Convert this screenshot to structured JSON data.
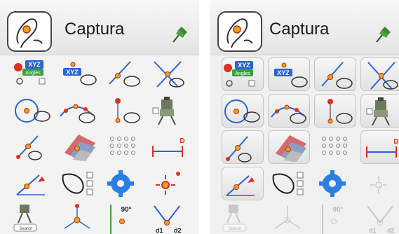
{
  "colors": {
    "accent_blue": "#2b63d6",
    "point_orange": "#f0a020",
    "point_red": "#e03020",
    "pin_green": "#3a8a2a"
  },
  "panels": [
    {
      "title": "Captura"
    },
    {
      "title": "Captura"
    }
  ],
  "icon_text": {
    "xyz": "XYZ",
    "angles": "Angles",
    "search": "Search",
    "fifty": "90°",
    "d1": "d1",
    "d2": "d2",
    "d": "D"
  },
  "tools": [
    {
      "name": "xyz-angles-icon"
    },
    {
      "name": "xyz-point-icon"
    },
    {
      "name": "line-point-icon"
    },
    {
      "name": "intersection-icon"
    },
    {
      "name": "circle-center-icon"
    },
    {
      "name": "arc-points-icon"
    },
    {
      "name": "vertical-pin-icon"
    },
    {
      "name": "total-station-icon"
    },
    {
      "name": "line-end-icon"
    },
    {
      "name": "grid-map-icon"
    },
    {
      "name": "point-grid-icon"
    },
    {
      "name": "distance-d-icon"
    },
    {
      "name": "slope-point-icon"
    },
    {
      "name": "lasso-list-icon"
    },
    {
      "name": "gear-settings-icon"
    },
    {
      "name": "snap-point-icon"
    },
    {
      "name": "station-search-icon"
    },
    {
      "name": "network-points-icon"
    },
    {
      "name": "angle-90-icon"
    },
    {
      "name": "distance-d1-d2-icon"
    }
  ]
}
